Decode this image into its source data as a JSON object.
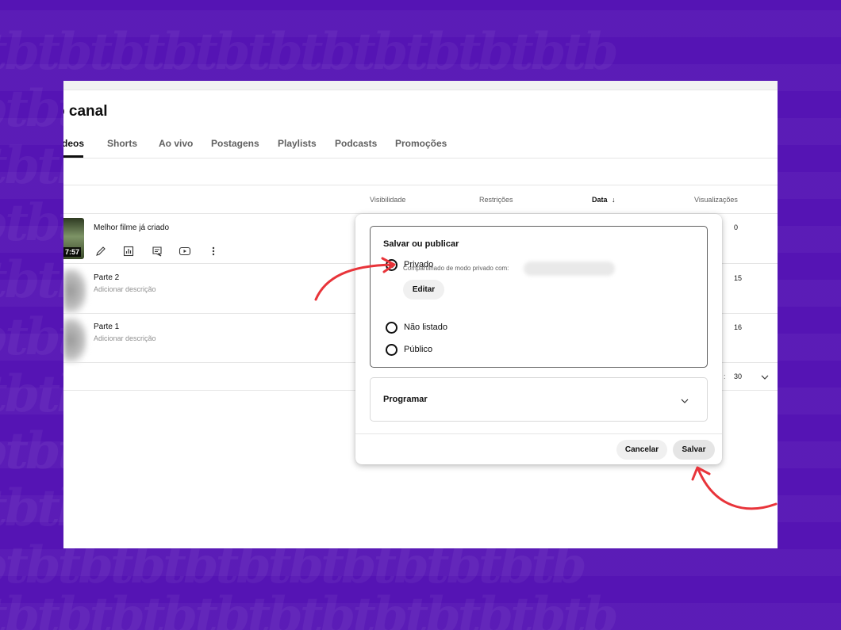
{
  "channel": {
    "title": "o canal",
    "tabs": [
      "deos",
      "Shorts",
      "Ao vivo",
      "Postagens",
      "Playlists",
      "Podcasts",
      "Promoções"
    ],
    "active_tab": "deos"
  },
  "table": {
    "columns": {
      "visibility": "Visibilidade",
      "restrictions": "Restrições",
      "date": "Data",
      "views": "Visualizações"
    },
    "rows": [
      {
        "title": "Melhor filme já criado",
        "duration": "7:57",
        "description": "",
        "views": "0"
      },
      {
        "title": "Parte 2",
        "duration": "",
        "description": "Adicionar descrição",
        "views": "15"
      },
      {
        "title": "Parte 1",
        "duration": "",
        "description": "Adicionar descrição",
        "views": "16"
      }
    ],
    "pager": {
      "rows_per_page": "30",
      "colon": ":"
    }
  },
  "row_actions": [
    "pencil-icon",
    "analytics-icon",
    "comments-icon",
    "youtube-icon",
    "more-vert-icon"
  ],
  "dialog": {
    "section_title": "Salvar ou publicar",
    "options": [
      {
        "label": "Privado",
        "checked": true
      },
      {
        "label": "Não listado",
        "checked": false
      },
      {
        "label": "Público",
        "checked": false
      }
    ],
    "shared_text": "Compartilhado de modo privado com:",
    "edit_label": "Editar",
    "schedule_label": "Programar",
    "cancel_label": "Cancelar",
    "save_label": "Salvar"
  },
  "colors": {
    "background": "#5514b4",
    "arrow": "#e8343a"
  }
}
